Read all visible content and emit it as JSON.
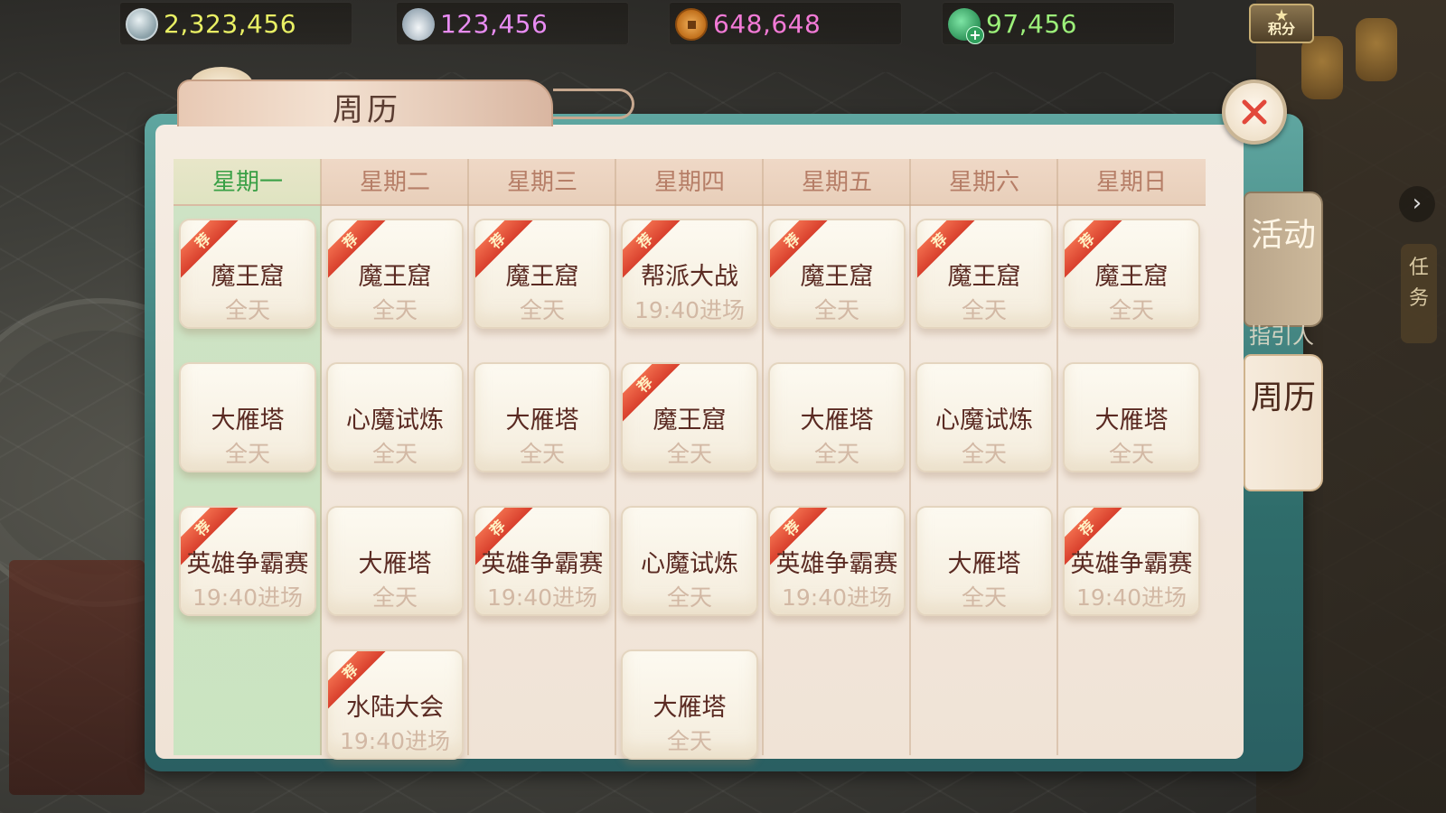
{
  "resources": [
    {
      "icon": "silver-coin-icon",
      "value": "2,323,456",
      "color": "#e9f064"
    },
    {
      "icon": "silver-ingot-icon",
      "value": "123,456",
      "color": "#e88cf2"
    },
    {
      "icon": "copper-coin-icon",
      "value": "648,648",
      "color": "#f27ad6"
    },
    {
      "icon": "jade-plus-icon",
      "value": "97,456",
      "color": "#9cf07a"
    }
  ],
  "score_button": {
    "label": "积分"
  },
  "panel": {
    "title": "周历"
  },
  "side_tabs": {
    "activity": "活动",
    "week": "周历"
  },
  "right_task": "任务",
  "guide_text": "指引人",
  "ribbon_label": "荐",
  "days": [
    {
      "label": "星期一",
      "selected": true,
      "events": [
        {
          "name": "魔王窟",
          "time": "全天",
          "rec": true
        },
        {
          "name": "大雁塔",
          "time": "全天",
          "rec": false
        },
        {
          "name": "英雄争霸赛",
          "time": "19:40进场",
          "rec": true
        }
      ]
    },
    {
      "label": "星期二",
      "selected": false,
      "events": [
        {
          "name": "魔王窟",
          "time": "全天",
          "rec": true
        },
        {
          "name": "心魔试炼",
          "time": "全天",
          "rec": false
        },
        {
          "name": "大雁塔",
          "time": "全天",
          "rec": false
        },
        {
          "name": "水陆大会",
          "time": "19:40进场",
          "rec": true
        }
      ]
    },
    {
      "label": "星期三",
      "selected": false,
      "events": [
        {
          "name": "魔王窟",
          "time": "全天",
          "rec": true
        },
        {
          "name": "大雁塔",
          "time": "全天",
          "rec": false
        },
        {
          "name": "英雄争霸赛",
          "time": "19:40进场",
          "rec": true
        }
      ]
    },
    {
      "label": "星期四",
      "selected": false,
      "events": [
        {
          "name": "帮派大战",
          "time": "19:40进场",
          "rec": true
        },
        {
          "name": "魔王窟",
          "time": "全天",
          "rec": true
        },
        {
          "name": "心魔试炼",
          "time": "全天",
          "rec": false
        },
        {
          "name": "大雁塔",
          "time": "全天",
          "rec": false
        }
      ]
    },
    {
      "label": "星期五",
      "selected": false,
      "events": [
        {
          "name": "魔王窟",
          "time": "全天",
          "rec": true
        },
        {
          "name": "大雁塔",
          "time": "全天",
          "rec": false
        },
        {
          "name": "英雄争霸赛",
          "time": "19:40进场",
          "rec": true
        }
      ]
    },
    {
      "label": "星期六",
      "selected": false,
      "events": [
        {
          "name": "魔王窟",
          "time": "全天",
          "rec": true
        },
        {
          "name": "心魔试炼",
          "time": "全天",
          "rec": false
        },
        {
          "name": "大雁塔",
          "time": "全天",
          "rec": false
        }
      ]
    },
    {
      "label": "星期日",
      "selected": false,
      "events": [
        {
          "name": "魔王窟",
          "time": "全天",
          "rec": true
        },
        {
          "name": "大雁塔",
          "time": "全天",
          "rec": false
        },
        {
          "name": "英雄争霸赛",
          "time": "19:40进场",
          "rec": true
        }
      ]
    }
  ]
}
